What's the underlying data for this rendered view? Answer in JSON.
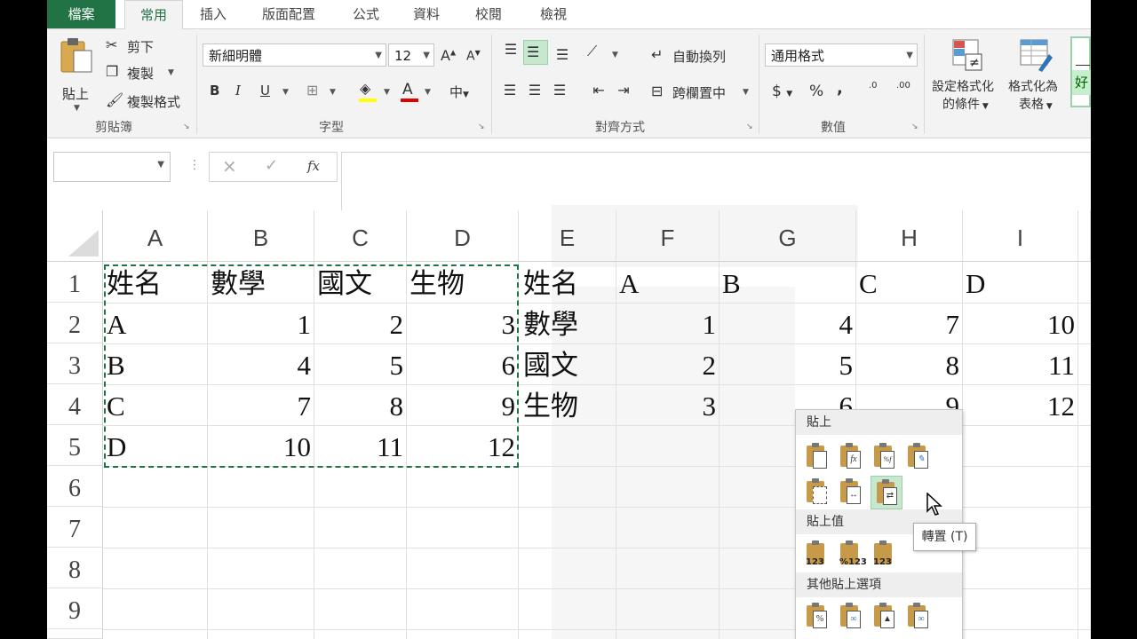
{
  "tabs": [
    "檔案",
    "常用",
    "插入",
    "版面配置",
    "公式",
    "資料",
    "校閱",
    "檢視"
  ],
  "ribbon": {
    "clipboard": {
      "paste": "貼上",
      "cut": "剪下",
      "copy": "複製",
      "format_painter": "複製格式",
      "label": "剪貼簿"
    },
    "font": {
      "name": "新細明體",
      "size": "12",
      "grow": "A",
      "shrink": "A",
      "bold": "B",
      "italic": "I",
      "underline": "U",
      "font_color_glyph": "A",
      "phonetic": "中",
      "label": "字型"
    },
    "alignment": {
      "wrap": "自動換列",
      "merge": "跨欄置中",
      "label": "對齊方式"
    },
    "number": {
      "format": "通用格式",
      "currency": "$",
      "percent": "%",
      "comma": ",",
      "inc_decimal": ".0",
      "dec_decimal": ".00",
      "label": "數值"
    },
    "styles": {
      "conditional": "設定格式化的條件",
      "conditional_l1": "設定格式化",
      "conditional_l2": "的條件",
      "as_table": "格式化為表格",
      "as_table_l1": "格式化為",
      "as_table_l2": "表格",
      "cell_style_glyph": "好"
    }
  },
  "formula_bar": {
    "name_box": "",
    "cancel": "×",
    "enter": "✓",
    "fx": "fx",
    "content": ""
  },
  "columns": [
    "A",
    "B",
    "C",
    "D",
    "E",
    "F",
    "G",
    "H",
    "I"
  ],
  "rows": [
    "1",
    "2",
    "3",
    "4",
    "5",
    "6",
    "7",
    "8",
    "9"
  ],
  "cells": {
    "r1": [
      "姓名",
      "數學",
      "國文",
      "生物",
      "姓名",
      "A",
      "B",
      "C",
      "D"
    ],
    "r2": [
      "A",
      "1",
      "2",
      "3",
      "數學",
      "1",
      "4",
      "7",
      "10"
    ],
    "r3": [
      "B",
      "4",
      "5",
      "6",
      "國文",
      "2",
      "5",
      "8",
      "11"
    ],
    "r4": [
      "C",
      "7",
      "8",
      "9",
      "生物",
      "3",
      "6",
      "9",
      "12"
    ],
    "r5": [
      "D",
      "10",
      "11",
      "12",
      "",
      "",
      "",
      "",
      ""
    ]
  },
  "paste_menu": {
    "section_paste": "貼上",
    "section_values": "貼上值",
    "section_other": "其他貼上選項",
    "tooltip": "轉置 (T)"
  },
  "colors": {
    "accent": "#217346",
    "highlight": "#c7e7cf"
  }
}
